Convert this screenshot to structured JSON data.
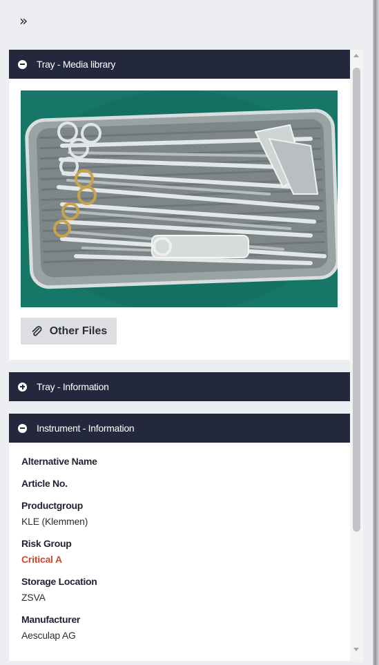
{
  "toolbar": {
    "expand_glyph": "»"
  },
  "panels": {
    "media": {
      "title": "Tray - Media library",
      "icon": "minus-circle-icon",
      "other_files_label": "Other Files",
      "other_files_icon": "paperclip-icon"
    },
    "tray_info": {
      "title": "Tray - Information",
      "icon": "plus-circle-icon"
    },
    "instrument_info": {
      "title": "Instrument - Information",
      "icon": "minus-circle-icon",
      "fields": [
        {
          "label": "Alternative Name",
          "value": ""
        },
        {
          "label": "Article No.",
          "value": ""
        },
        {
          "label": "Productgroup",
          "value": "KLE (Klemmen)"
        },
        {
          "label": "Risk Group",
          "value": "Critical A",
          "value_color": "#c94c2c"
        },
        {
          "label": "Storage Location",
          "value": "ZSVA"
        },
        {
          "label": "Manufacturer",
          "value": "Aesculap AG"
        }
      ]
    }
  },
  "colors": {
    "header_bg": "#23283d",
    "accent_critical": "#c94c2c",
    "page_bg": "#eceef1"
  }
}
